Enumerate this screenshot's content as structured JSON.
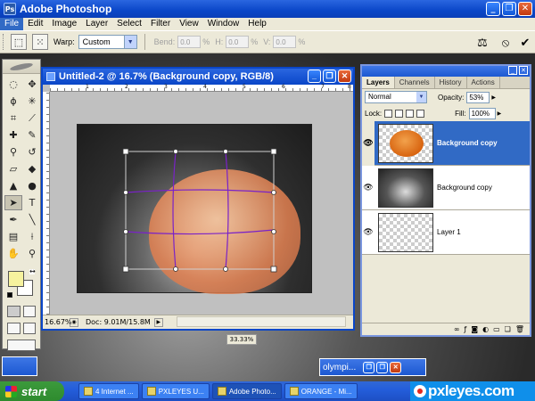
{
  "app": {
    "title": "Adobe Photoshop",
    "logo_letters": "Ps"
  },
  "window_buttons": {
    "minimize": "_",
    "restore": "❐",
    "close": "✕"
  },
  "menu": [
    "File",
    "Edit",
    "Image",
    "Layer",
    "Select",
    "Filter",
    "View",
    "Window",
    "Help"
  ],
  "options_bar": {
    "warp_label": "Warp:",
    "warp_value": "Custom",
    "bend_label": "Bend:",
    "bend_value": "0.0",
    "h_label": "H:",
    "h_value": "0.0",
    "v_label": "V:",
    "v_value": "0.0",
    "percent": "%",
    "commit_icon": "check-icon",
    "cancel_icon": "cancel-icon"
  },
  "document": {
    "title": "Untitled-2 @ 16.7% (Background copy, RGB/8)",
    "zoom": "16.67%",
    "doc_info": "Doc: 9.01M/15.8M",
    "ruler_marks": [
      "1",
      "2",
      "3",
      "4",
      "5",
      "6",
      "7",
      "8"
    ]
  },
  "bottom_zoom": "33.33%",
  "layers_panel": {
    "tabs": [
      "Layers",
      "Channels",
      "History",
      "Actions"
    ],
    "blend_mode": "Normal",
    "opacity_label": "Opacity:",
    "opacity_value": "53%",
    "lock_label": "Lock:",
    "fill_label": "Fill:",
    "fill_value": "100%",
    "layers": [
      {
        "name": "Background copy",
        "selected": true
      },
      {
        "name": "Background copy",
        "selected": false
      },
      {
        "name": "Layer 1",
        "selected": false
      }
    ],
    "eye_glyph": "👁"
  },
  "minimized_window": {
    "title": "olympi..."
  },
  "taskbar": {
    "start_label": "start",
    "tasks": [
      "4 Internet ...",
      "PXLEYES U...",
      "Adobe Photo...",
      "ORANGE - Mi..."
    ],
    "brand_text": "pxleyes.com"
  },
  "colors": {
    "xp_blue": "#0a46c8",
    "selection_blue": "#316ac5",
    "foreground_swatch": "#f6f29e",
    "background_swatch": "#ffffff",
    "warp_grid_purple": "#7a22c8"
  }
}
